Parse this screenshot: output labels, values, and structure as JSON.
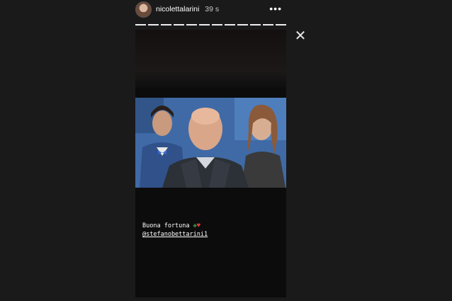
{
  "header": {
    "username": "nicolettalarini",
    "time": "39 s",
    "more_icon": "more-horizontal-icon"
  },
  "progress": {
    "segments": 12,
    "current": 12
  },
  "close_icon": "close-icon",
  "caption": {
    "text": "Buona fortuna",
    "emoji": [
      "clover-icon",
      "heart-icon"
    ],
    "mention": "@stefanobettarini1"
  },
  "colors": {
    "background": "#1a1a1a",
    "story_bg": "#0c0c0c",
    "heart": "#e0353b",
    "clover": "#4caf50"
  }
}
